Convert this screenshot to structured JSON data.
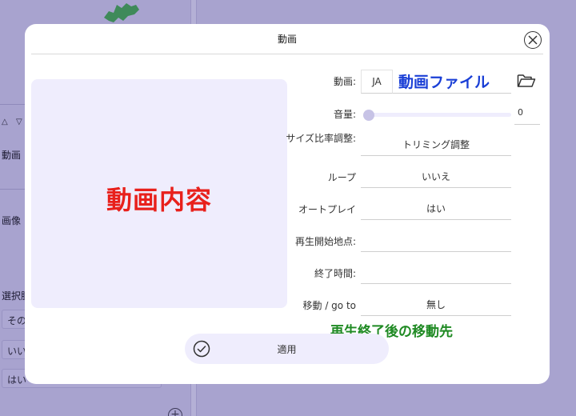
{
  "background": {
    "panel_labels": {
      "video": "動画",
      "image": "画像",
      "choices": "選択肢"
    },
    "options": [
      "その",
      "いい",
      "はい"
    ],
    "toolbar": {
      "up": "△",
      "down": "▽"
    }
  },
  "modal": {
    "title": "動画",
    "preview_annotation": "動画内容",
    "fields": {
      "video": {
        "label": "動画:",
        "lang": "JA",
        "annotation": "動画ファイル"
      },
      "volume": {
        "label": "音量:",
        "value": "0",
        "level": 0
      },
      "size": {
        "label": "サイズ比率調整:",
        "value": "トリミング調整"
      },
      "loop": {
        "label": "ループ",
        "value": "いいえ"
      },
      "autoplay": {
        "label": "オートプレイ",
        "value": "はい"
      },
      "start": {
        "label": "再生開始地点:",
        "value": ""
      },
      "end": {
        "label": "終了時間:",
        "value": ""
      },
      "goto": {
        "label": "移動 / go to",
        "value": "無し",
        "annotation": "再生終了後の移動先"
      }
    },
    "apply_label": "適用"
  },
  "colors": {
    "overlay": "#a8a3cf",
    "preview_bg": "#efedfd",
    "annotation_red": "#e8201b",
    "annotation_blue": "#1a3fd6",
    "annotation_green": "#1f8a23"
  }
}
